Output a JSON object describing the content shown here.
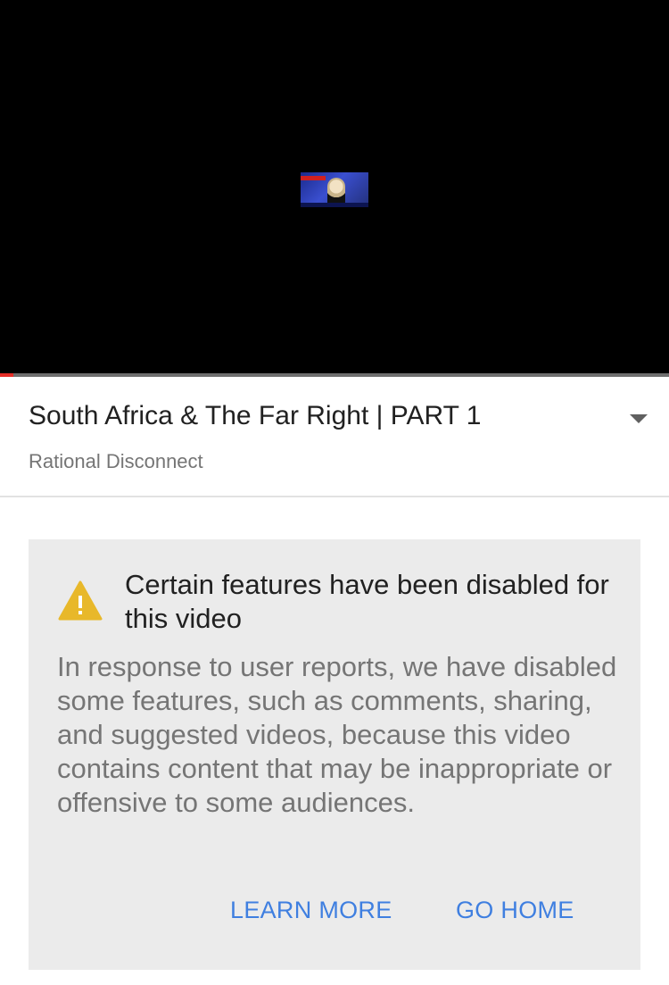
{
  "player": {
    "progress_fraction": 0.02,
    "progress_color": "#e52d27"
  },
  "video": {
    "title": "South Africa & The Far Right | PART 1",
    "channel": "Rational Disconnect",
    "expand_icon": "chevron-down-icon"
  },
  "notice": {
    "icon": "warning-icon",
    "icon_color": "#e8b82a",
    "title": "Certain features have been disabled for this video",
    "body": "In response to user reports, we have disabled some features, such as comments, sharing, and suggested videos, because this video contains content that may be inappropriate or offensive to some audiences.",
    "learn_more_label": "LEARN MORE",
    "go_home_label": "GO HOME",
    "link_color": "#3f7fe0"
  }
}
